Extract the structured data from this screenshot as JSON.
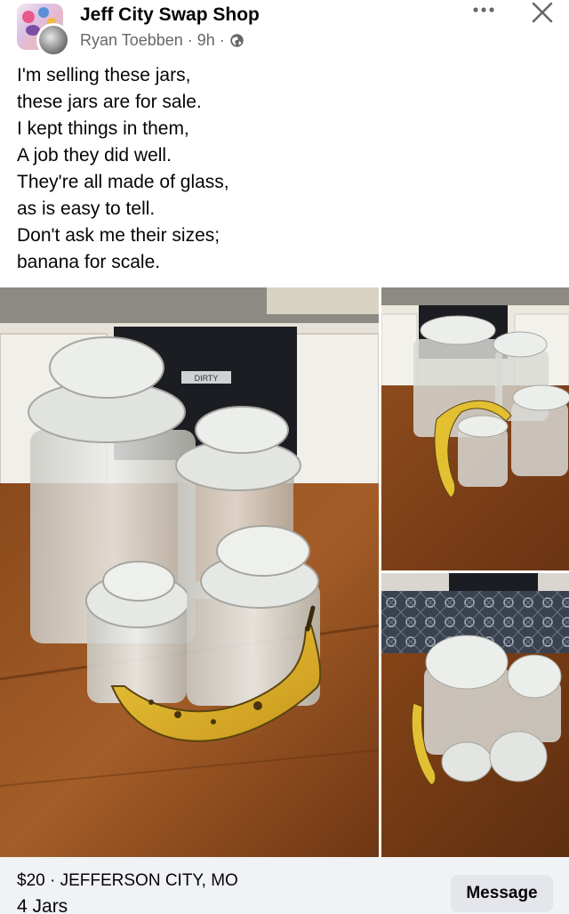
{
  "header": {
    "group_name": "Jeff City Swap Shop",
    "author": "Ryan Toebben",
    "separator": "·",
    "time": "9h",
    "privacy_icon": "globe-icon",
    "more_icon": "more-horizontal-icon",
    "close_icon": "close-icon"
  },
  "post": {
    "lines": [
      "I'm selling these jars,",
      "these jars are for sale.",
      "I kept things in them,",
      "A job they did well.",
      "They're all made of glass,",
      "as is easy to tell.",
      "Don't ask me their sizes;",
      "banana for scale."
    ]
  },
  "photos": {
    "main_label": "DIRTY"
  },
  "listing": {
    "price_line": "$20 · JEFFERSON CITY, MO",
    "title": "4 Jars",
    "message_label": "Message"
  },
  "colors": {
    "text_primary": "#050505",
    "text_secondary": "#65676b",
    "footer_bg": "#f0f2f5",
    "button_bg": "#e4e6eb"
  }
}
